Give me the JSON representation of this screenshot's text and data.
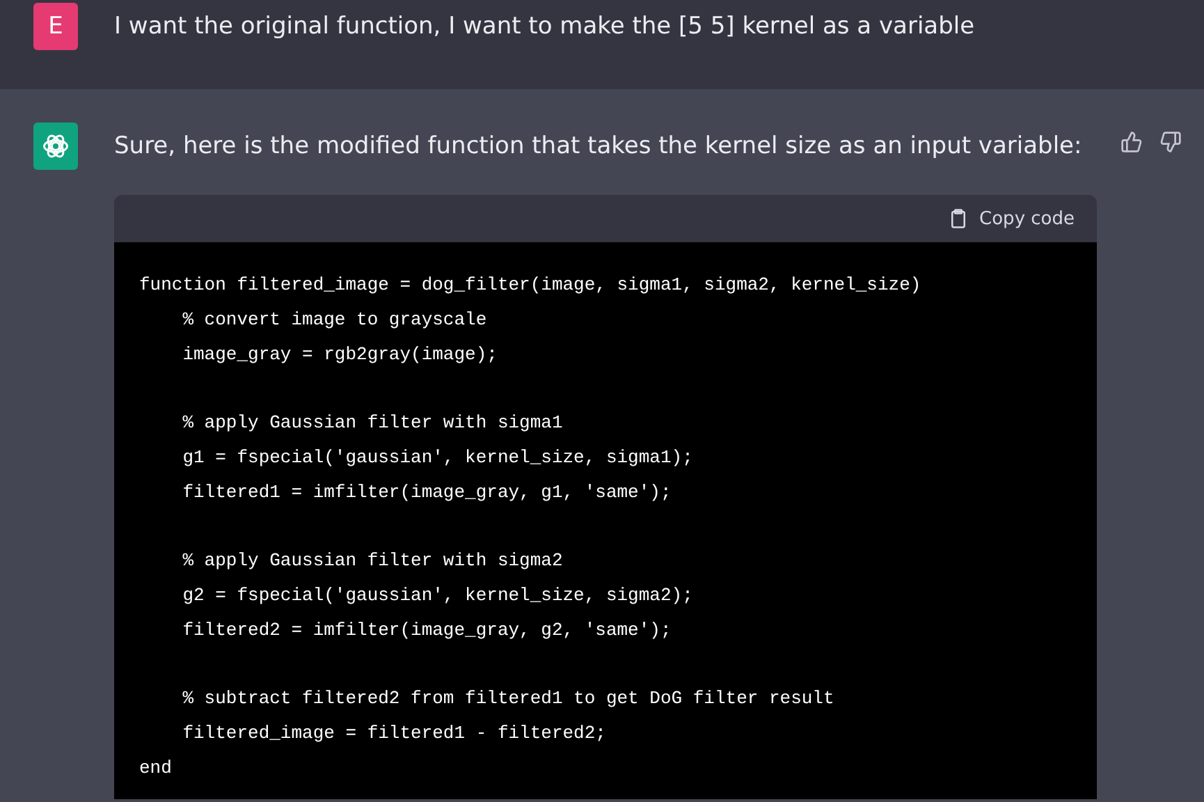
{
  "user_message": {
    "avatar": "E",
    "text": "I want the original function, I want to make the [5 5] kernel as a variable"
  },
  "assistant_message": {
    "text": "Sure, here is the modified function that takes the kernel size as an input variable:",
    "code_block": {
      "copy_label": "Copy code",
      "blocks": [
        [
          "function filtered_image = dog_filter(image, sigma1, sigma2, kernel_size)",
          "    % convert image to grayscale",
          "    image_gray = rgb2gray(image);"
        ],
        [
          "    % apply Gaussian filter with sigma1",
          "    g1 = fspecial('gaussian', kernel_size, sigma1);",
          "    filtered1 = imfilter(image_gray, g1, 'same');"
        ],
        [
          "    % apply Gaussian filter with sigma2",
          "    g2 = fspecial('gaussian', kernel_size, sigma2);",
          "    filtered2 = imfilter(image_gray, g2, 'same');"
        ],
        [
          "    % subtract filtered2 from filtered1 to get DoG filter result",
          "    filtered_image = filtered1 - filtered2;",
          "end"
        ]
      ]
    }
  }
}
